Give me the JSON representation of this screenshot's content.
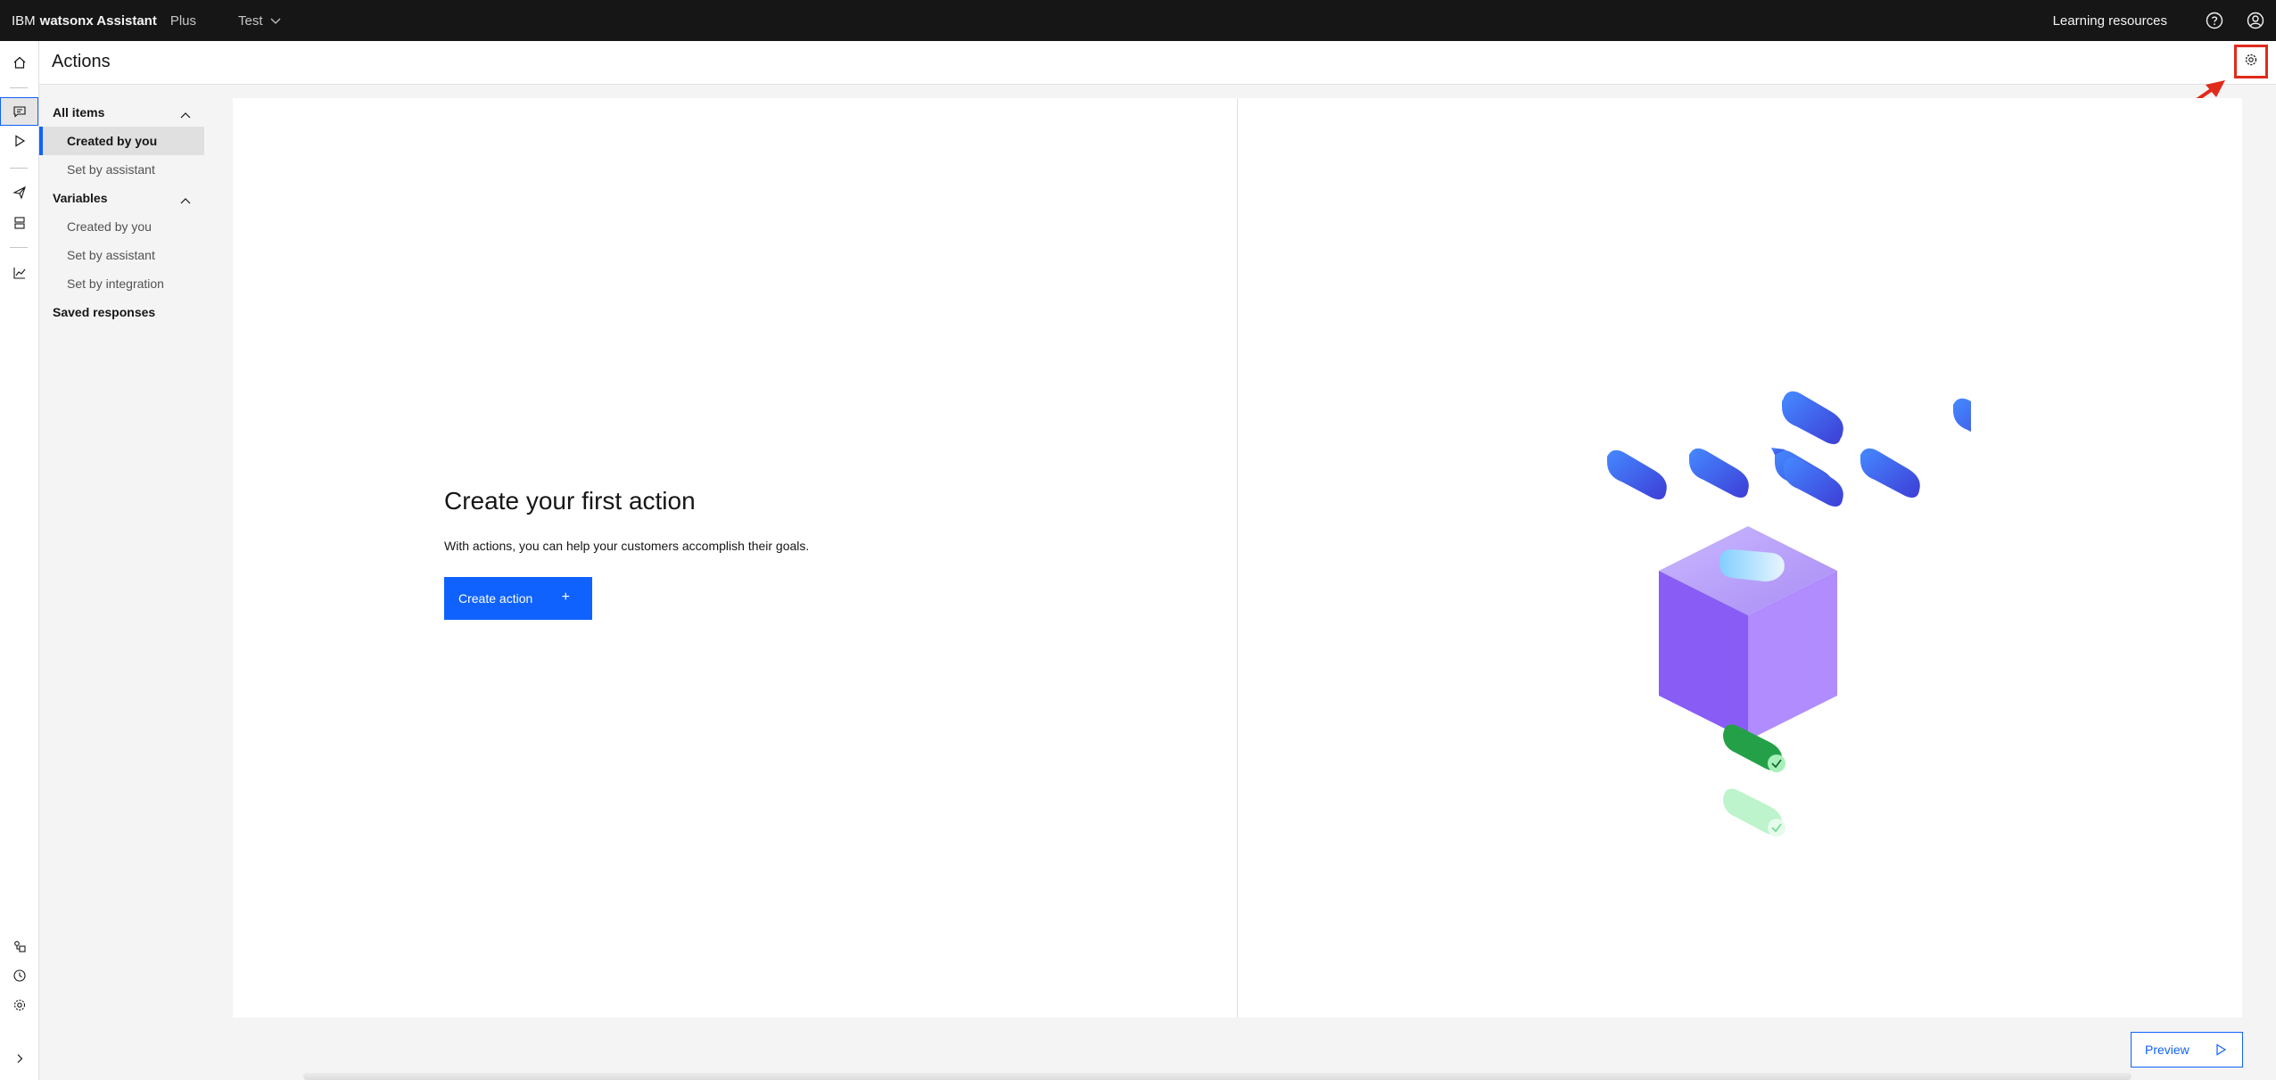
{
  "app": {
    "brand_ibm": "IBM",
    "brand_name": "watsonx Assistant",
    "plan": "Plus"
  },
  "header": {
    "assistant_name": "Test",
    "learning_resources": "Learning resources"
  },
  "page": {
    "title": "Actions"
  },
  "nav": {
    "all_items": "All items",
    "all_created": "Created by you",
    "all_set_by_assistant": "Set by assistant",
    "variables": "Variables",
    "var_created": "Created by you",
    "var_set_by_assistant": "Set by assistant",
    "var_set_by_integration": "Set by integration",
    "saved_responses": "Saved responses"
  },
  "empty_state": {
    "title": "Create your first action",
    "description": "With actions, you can help your customers accomplish their goals.",
    "button": "Create action",
    "button_icon": "+"
  },
  "footer": {
    "preview": "Preview"
  },
  "colors": {
    "primary": "#0f62fe",
    "highlight": "#e02b1b",
    "topbar": "#161616"
  }
}
